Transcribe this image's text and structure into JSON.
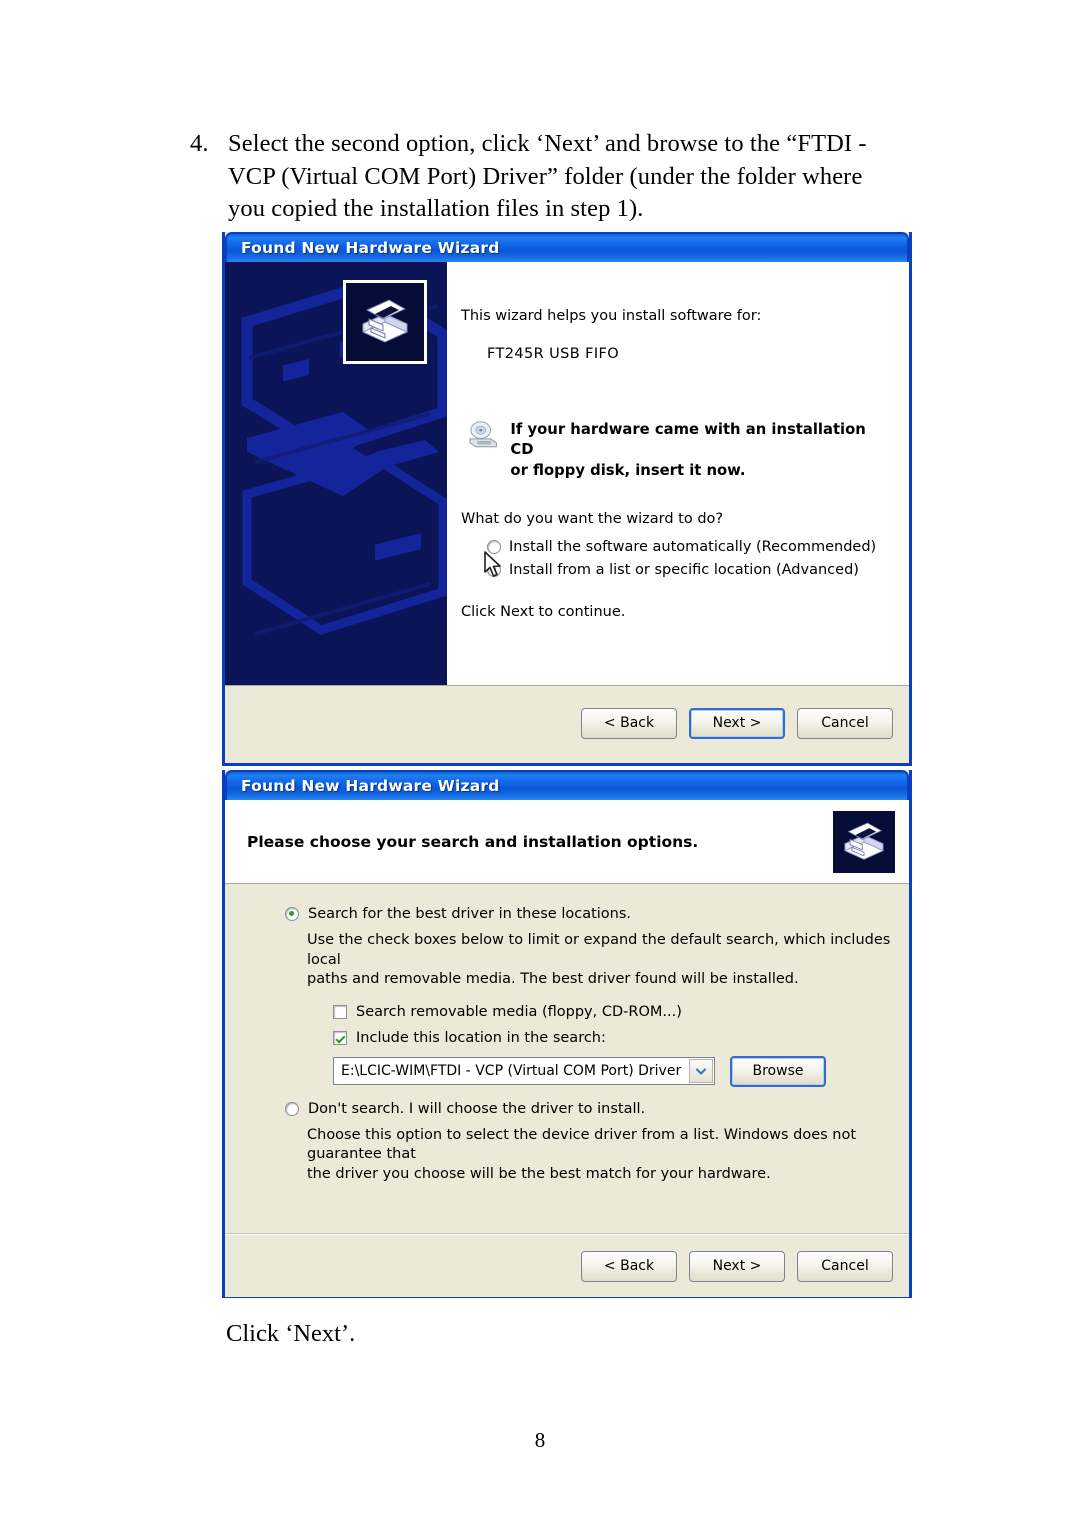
{
  "document": {
    "step_number": "4.",
    "step_text": "Select the second option, click ‘Next’ and browse to the “FTDI - VCP (Virtual COM Port) Driver” folder (under the folder where you copied the installation files in step 1).",
    "closing_text": "Click ‘Next’.",
    "page_number": "8"
  },
  "colors": {
    "title_blue": "#1164e8",
    "dialog_border": "#0a3fc0",
    "watermark_navy": "#0a1456",
    "dialog_face": "#ece9d8",
    "radio_green": "#2f9e2f",
    "check_green": "#1f9c28"
  },
  "dialog_welcome": {
    "title": "Found New Hardware Wizard",
    "icon": "wizard-hardware-icon",
    "intro": "This wizard helps you install software for:",
    "device_name": "FT245R USB FIFO",
    "cd_icon": "cd-drive-icon",
    "cd_note_line1": "If your hardware came with an installation CD",
    "cd_note_line2": "or floppy disk, insert it now.",
    "question": "What do you want the wizard to do?",
    "options": [
      {
        "label": "Install the software automatically (Recommended)",
        "selected": false
      },
      {
        "label": "Install from a list or specific location (Advanced)",
        "selected": true
      }
    ],
    "click_next": "Click Next to continue.",
    "buttons": {
      "back": "< Back",
      "next": "Next >",
      "cancel": "Cancel",
      "default": "next"
    }
  },
  "dialog_options": {
    "title": "Found New Hardware Wizard",
    "heading": "Please choose your search and installation options.",
    "icon": "wizard-hardware-icon",
    "option_search": {
      "label": "Search for the best driver in these locations.",
      "selected": true,
      "helper_line1": "Use the check boxes below to limit or expand the default search, which includes local",
      "helper_line2": "paths and removable media. The best driver found will be installed."
    },
    "checkboxes": [
      {
        "label": "Search removable media (floppy, CD-ROM...)",
        "checked": false
      },
      {
        "label": "Include this location in the search:",
        "checked": true
      }
    ],
    "location": {
      "value": "E:\\LCIC-WIM\\FTDI - VCP (Virtual COM Port) Driver",
      "dropdown_icon": "chevron-down-icon",
      "browse_label": "Browse"
    },
    "option_dontsearch": {
      "label": "Don't search. I will choose the driver to install.",
      "selected": false,
      "helper_line1": "Choose this option to select the device driver from a list.  Windows does not guarantee that",
      "helper_line2": "the driver you choose will be the best match for your hardware."
    },
    "buttons": {
      "back": "< Back",
      "next": "Next >",
      "cancel": "Cancel",
      "default": "none"
    }
  }
}
